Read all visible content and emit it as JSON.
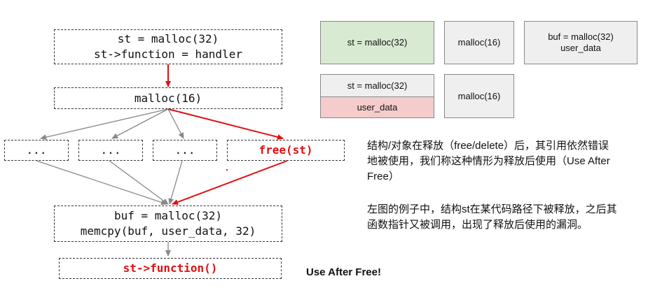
{
  "flow": {
    "box1": {
      "line1": "st = malloc(32)",
      "line2": "st->function = handler"
    },
    "box2": "malloc(16)",
    "branches": [
      "...",
      "...",
      "...",
      "free(st)"
    ],
    "box4": {
      "line1": "buf = malloc(32)",
      "line2": "memcpy(buf, user_data, 32)"
    },
    "box5": "st->function()"
  },
  "memory": {
    "row1": [
      "st = malloc(32)",
      "malloc(16)",
      "buf = malloc(32)",
      "user_data"
    ],
    "row2": {
      "split_top": "st = malloc(32)",
      "split_bottom": "user_data",
      "right": "malloc(16)"
    }
  },
  "text": {
    "para1": "结构/对象在释放（free/delete）后，其引用依然错误地被使用，我们称这种情形为释放后使用（Use After Free）",
    "para2": "左图的例子中，结构st在某代码路径下被释放，之后其函数指针又被调用，出现了释放后使用的漏洞。",
    "footer": "Use After Free!"
  },
  "colors": {
    "red": "#e01010",
    "gray_arrow": "#888888",
    "green_fill": "#d9ead3",
    "gray_fill": "#efefef",
    "pink_fill": "#f4cccc"
  }
}
